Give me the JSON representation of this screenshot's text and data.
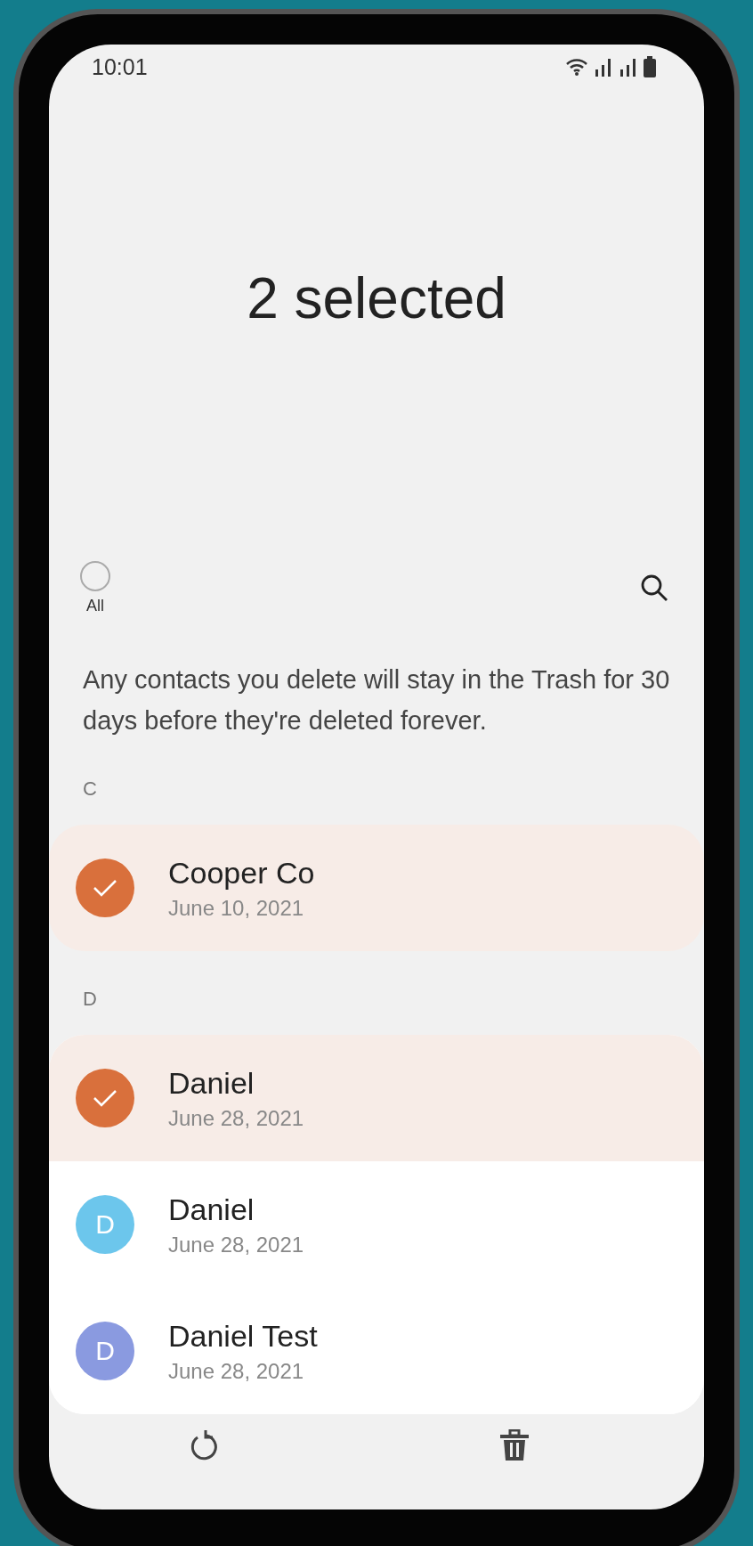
{
  "status_bar": {
    "time": "10:01"
  },
  "header": {
    "title": "2 selected"
  },
  "select_all": {
    "label": "All",
    "checked": false
  },
  "notice": "Any contacts you delete will stay in the Trash for 30 days before they're deleted forever.",
  "sections": [
    {
      "letter": "C",
      "contacts": [
        {
          "name": "Cooper Co",
          "date": "June 10, 2021",
          "selected": true,
          "color": "#d9703c"
        }
      ]
    },
    {
      "letter": "D",
      "contacts": [
        {
          "name": "Daniel",
          "date": "June 28, 2021",
          "selected": true,
          "color": "#d9703c"
        },
        {
          "name": "Daniel",
          "date": "June 28, 2021",
          "selected": false,
          "avatar_letter": "D",
          "color": "#6cc6ec"
        },
        {
          "name": "Daniel Test",
          "date": "June 28, 2021",
          "selected": false,
          "avatar_letter": "D",
          "color": "#8a9ae0"
        }
      ]
    }
  ],
  "bottom_bar": [
    {
      "kind": "restore"
    },
    {
      "kind": "delete"
    }
  ]
}
